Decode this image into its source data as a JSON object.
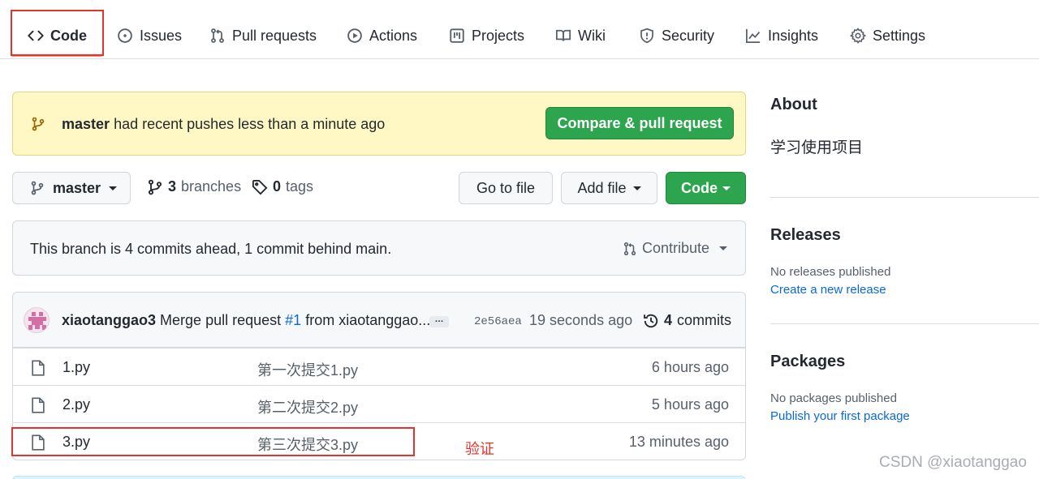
{
  "nav": {
    "tabs": [
      {
        "label": "Code",
        "icon": "code-icon",
        "selected": true
      },
      {
        "label": "Issues",
        "icon": "issue-opened-icon"
      },
      {
        "label": "Pull requests",
        "icon": "git-pull-request-icon"
      },
      {
        "label": "Actions",
        "icon": "play-icon"
      },
      {
        "label": "Projects",
        "icon": "project-icon"
      },
      {
        "label": "Wiki",
        "icon": "book-icon"
      },
      {
        "label": "Security",
        "icon": "shield-icon"
      },
      {
        "label": "Insights",
        "icon": "graph-icon"
      },
      {
        "label": "Settings",
        "icon": "gear-icon"
      }
    ]
  },
  "flash": {
    "branch": "master",
    "message": "had recent pushes less than a minute ago",
    "button": "Compare & pull request"
  },
  "branch_bar": {
    "branch": "master",
    "branches_count": "3",
    "branches_label": "branches",
    "tags_count": "0",
    "tags_label": "tags",
    "go_to_file": "Go to file",
    "add_file": "Add file",
    "code": "Code"
  },
  "compare": {
    "text": "This branch is 4 commits ahead, 1 commit behind main.",
    "contribute": "Contribute"
  },
  "latest_commit": {
    "author": "xiaotanggao3",
    "message_prefix": "Merge pull request",
    "pr": "#1",
    "message_suffix": "from xiaotanggao...",
    "ellipsis": "…",
    "sha": "2e56aea",
    "time": "19 seconds ago",
    "commits_count": "4",
    "commits_label": "commits"
  },
  "files": [
    {
      "name": "1.py",
      "commit": "第一次提交1.py",
      "age": "6 hours ago"
    },
    {
      "name": "2.py",
      "commit": "第二次提交2.py",
      "age": "5 hours ago"
    },
    {
      "name": "3.py",
      "commit": "第三次提交3.py",
      "age": "13 minutes ago"
    }
  ],
  "annotation": "验证",
  "sidebar": {
    "about_title": "About",
    "description": "学习使用项目",
    "releases_title": "Releases",
    "releases_empty": "No releases published",
    "releases_link": "Create a new release",
    "packages_title": "Packages",
    "packages_empty": "No packages published",
    "packages_link": "Publish your first package"
  },
  "watermark": "CSDN @xiaotanggao",
  "colors": {
    "green": "#2da44e",
    "link": "#0969da",
    "annotation_red": "#e5332a",
    "flash_bg": "#fff8c5"
  }
}
